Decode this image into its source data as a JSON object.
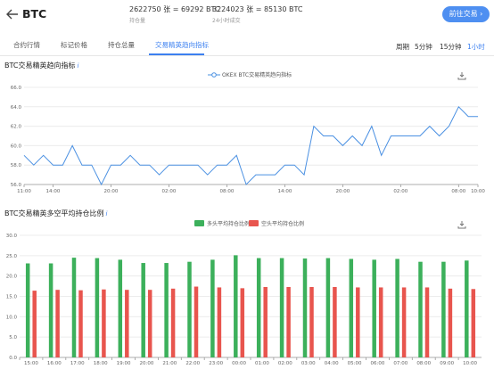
{
  "header": {
    "title": "BTC",
    "open_interest_value": "2622750 张 = 69292 BTC",
    "open_interest_label": "持仓量",
    "volume_value": "3224023 张 = 85130 BTC",
    "volume_label": "24小时成交",
    "trade_button": "前往交易"
  },
  "tabs": [
    {
      "label": "合约行情",
      "active": false
    },
    {
      "label": "标记价格",
      "active": false
    },
    {
      "label": "持仓总量",
      "active": false
    },
    {
      "label": "交易精英趋向指标",
      "active": true
    }
  ],
  "period": {
    "label": "周期",
    "options": [
      {
        "label": "5分钟",
        "active": false
      },
      {
        "label": "15分钟",
        "active": false
      },
      {
        "label": "1小时",
        "active": true
      }
    ]
  },
  "colors": {
    "accent": "#3c80f0",
    "line": "#4a90e2",
    "long_bar": "#3cb05b",
    "short_bar": "#e8554e"
  },
  "chart1": {
    "section_title": "BTC交易精英趋向指标",
    "legend": "OKEX BTC交易精英趋向指标"
  },
  "chart2": {
    "section_title": "BTC交易精英多空平均持仓比例",
    "legend_long": "多头平均持仓比例",
    "legend_short": "空头平均持仓比例"
  },
  "icons": {
    "back": "back-arrow-icon",
    "info": "info-icon",
    "download": "download-icon"
  },
  "chart_data": [
    {
      "type": "line",
      "ylim": [
        56.0,
        66.0
      ],
      "y_ticks": [
        "56.0",
        "58.0",
        "60.0",
        "62.0",
        "64.0",
        "66.0"
      ],
      "x_ticks": [
        "11:00",
        "14:00",
        "20:00",
        "02:00",
        "08:00",
        "14:00",
        "20:00",
        "02:00",
        "08:00",
        "10:00"
      ],
      "x_tick_index": [
        0,
        3,
        9,
        15,
        21,
        27,
        33,
        39,
        45,
        47
      ],
      "series": [
        {
          "name": "OKEX BTC交易精英趋向指标",
          "values": [
            59,
            58,
            59,
            58,
            58,
            60,
            58,
            58,
            56,
            58,
            58,
            59,
            58,
            58,
            57,
            58,
            58,
            58,
            58,
            57,
            58,
            58,
            59,
            56,
            57,
            57,
            57,
            58,
            58,
            57,
            62,
            61,
            61,
            60,
            61,
            60,
            62,
            59,
            61,
            61,
            61,
            61,
            62,
            61,
            62,
            64,
            63,
            63
          ]
        }
      ],
      "grid": true
    },
    {
      "type": "bar",
      "ylim": [
        0,
        30.0
      ],
      "y_ticks": [
        "0.0",
        "5.0",
        "10.0",
        "15.0",
        "20.0",
        "25.0",
        "30.0"
      ],
      "categories": [
        "15:00",
        "16:00",
        "17:00",
        "18:00",
        "19:00",
        "20:00",
        "21:00",
        "22:00",
        "23:00",
        "00:00",
        "01:00",
        "02:00",
        "03:00",
        "04:00",
        "05:00",
        "06:00",
        "07:00",
        "08:00",
        "09:00",
        "10:00"
      ],
      "series": [
        {
          "name": "多头平均持仓比例",
          "values": [
            23.1,
            23.1,
            24.5,
            24.4,
            24.0,
            23.2,
            23.2,
            23.5,
            24.0,
            25.1,
            24.4,
            24.4,
            24.3,
            24.4,
            24.2,
            24.0,
            24.2,
            23.5,
            23.5,
            23.8
          ]
        },
        {
          "name": "空头平均持仓比例",
          "values": [
            16.4,
            16.6,
            16.5,
            16.7,
            16.6,
            16.6,
            16.9,
            17.4,
            17.2,
            17.0,
            17.3,
            17.3,
            17.3,
            17.3,
            17.2,
            17.2,
            17.2,
            17.2,
            16.9,
            16.8
          ]
        }
      ],
      "grid": true
    }
  ]
}
